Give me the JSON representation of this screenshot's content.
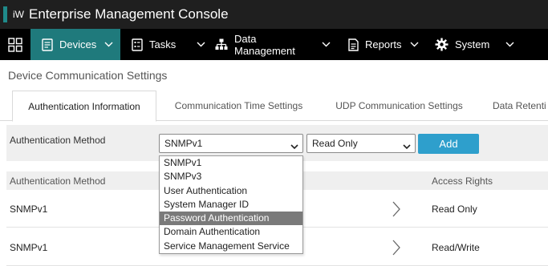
{
  "app": {
    "logo": "iW",
    "title": "Enterprise Management Console"
  },
  "nav": {
    "items": [
      {
        "label": "Devices",
        "icon": "devices-icon",
        "active": true
      },
      {
        "label": "Tasks",
        "icon": "tasks-icon"
      },
      {
        "label": "Data Management",
        "icon": "hierarchy-icon"
      },
      {
        "label": "Reports",
        "icon": "reports-icon"
      },
      {
        "label": "System",
        "icon": "gear-icon"
      }
    ]
  },
  "page": {
    "title": "Device Communication Settings"
  },
  "tabs": [
    {
      "label": "Authentication Information",
      "active": true
    },
    {
      "label": "Communication Time Settings"
    },
    {
      "label": "UDP Communication Settings"
    },
    {
      "label": "Data Retenti"
    }
  ],
  "form": {
    "label": "Authentication Method",
    "method_value": "SNMPv1",
    "access_value": "Read Only",
    "add_label": "Add"
  },
  "dropdown": {
    "options": [
      "SNMPv1",
      "SNMPv3",
      "User Authentication",
      "System Manager ID",
      "Password Authentication",
      "Domain Authentication",
      "Service Management Service"
    ],
    "highlighted": "Password Authentication"
  },
  "table": {
    "columns": [
      "Authentication Method",
      "Access Rights"
    ],
    "rows": [
      {
        "method": "SNMPv1",
        "access": "Read Only"
      },
      {
        "method": "SNMPv1",
        "access": "Read/Write"
      }
    ]
  },
  "colors": {
    "titlebar": "#1f1f1f",
    "navbar": "#000000",
    "nav_active": "#1f7a7c",
    "add_button": "#2e9fcc",
    "dropdown_highlight": "#7a7a7a"
  }
}
